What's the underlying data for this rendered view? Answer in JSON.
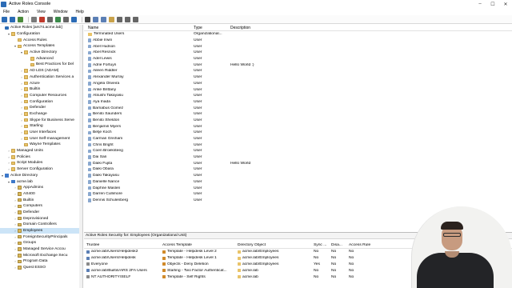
{
  "window": {
    "title": "Active Roles Console",
    "controls": [
      "–",
      "☐",
      "✕"
    ]
  },
  "menu": [
    "File",
    "Action",
    "View",
    "Window",
    "Help"
  ],
  "toolbar": [
    "back",
    "forward",
    "up",
    "show-tree",
    "delete",
    "properties",
    "refresh",
    "export",
    "help",
    "console-icon",
    "new-user",
    "new-group",
    "new-ou",
    "filter",
    "find",
    "settings"
  ],
  "tree": [
    {
      "label": "Active Roles [ars74.acme.lab]",
      "indent": 0,
      "exp": "",
      "icon": "root"
    },
    {
      "label": "Configuration",
      "indent": 1,
      "exp": "▾",
      "icon": "folder"
    },
    {
      "label": "Access Rules",
      "indent": 2,
      "exp": "",
      "icon": "folder"
    },
    {
      "label": "Access Templates",
      "indent": 2,
      "exp": "▾",
      "icon": "folder"
    },
    {
      "label": "Active Directory",
      "indent": 3,
      "exp": "▾",
      "icon": "folder"
    },
    {
      "label": "Advanced",
      "indent": 4,
      "exp": "",
      "icon": "folder"
    },
    {
      "label": "Best Practices for Del",
      "indent": 4,
      "exp": "",
      "icon": "folder"
    },
    {
      "label": "AD LDS (ADAM)",
      "indent": 3,
      "exp": "›",
      "icon": "folder"
    },
    {
      "label": "Authentication Services a",
      "indent": 3,
      "exp": "›",
      "icon": "folder"
    },
    {
      "label": "Azure",
      "indent": 3,
      "exp": "›",
      "icon": "folder"
    },
    {
      "label": "Builtin",
      "indent": 3,
      "exp": "›",
      "icon": "folder"
    },
    {
      "label": "Computer Resources",
      "indent": 3,
      "exp": "›",
      "icon": "folder"
    },
    {
      "label": "Configuration",
      "indent": 3,
      "exp": "›",
      "icon": "folder"
    },
    {
      "label": "Defender",
      "indent": 3,
      "exp": "›",
      "icon": "folder"
    },
    {
      "label": "Exchange",
      "indent": 3,
      "exp": "›",
      "icon": "folder"
    },
    {
      "label": "Skype for Business Serve",
      "indent": 3,
      "exp": "›",
      "icon": "folder"
    },
    {
      "label": "Starling",
      "indent": 3,
      "exp": "›",
      "icon": "folder"
    },
    {
      "label": "User Interfaces",
      "indent": 3,
      "exp": "›",
      "icon": "folder"
    },
    {
      "label": "User Self-management",
      "indent": 3,
      "exp": "›",
      "icon": "folder"
    },
    {
      "label": "Wayne Templates",
      "indent": 3,
      "exp": "",
      "icon": "folder"
    },
    {
      "label": "Managed Units",
      "indent": 1,
      "exp": "›",
      "icon": "folder"
    },
    {
      "label": "Policies",
      "indent": 1,
      "exp": "›",
      "icon": "folder"
    },
    {
      "label": "Script Modules",
      "indent": 1,
      "exp": "›",
      "icon": "folder"
    },
    {
      "label": "Server Configuration",
      "indent": 1,
      "exp": "›",
      "icon": "folder"
    },
    {
      "label": "Active Directory",
      "indent": 0,
      "exp": "▾",
      "icon": "node"
    },
    {
      "label": "acme.lab",
      "indent": 1,
      "exp": "▾",
      "icon": "node"
    },
    {
      "label": "AppAdmins",
      "indent": 2,
      "exp": "›",
      "icon": "ou"
    },
    {
      "label": "AS400",
      "indent": 2,
      "exp": "›",
      "icon": "ou"
    },
    {
      "label": "Builtin",
      "indent": 2,
      "exp": "›",
      "icon": "ou"
    },
    {
      "label": "Computers",
      "indent": 2,
      "exp": "›",
      "icon": "ou"
    },
    {
      "label": "Defender",
      "indent": 2,
      "exp": "›",
      "icon": "ou"
    },
    {
      "label": "Deprovisioned",
      "indent": 2,
      "exp": "›",
      "icon": "ou"
    },
    {
      "label": "Domain Controllers",
      "indent": 2,
      "exp": "›",
      "icon": "ou"
    },
    {
      "label": "Employees",
      "indent": 2,
      "exp": "›",
      "icon": "ou",
      "selected": true
    },
    {
      "label": "ForeignSecurityPrincipals",
      "indent": 2,
      "exp": "›",
      "icon": "ou"
    },
    {
      "label": "Groups",
      "indent": 2,
      "exp": "›",
      "icon": "ou"
    },
    {
      "label": "Managed Service Accou",
      "indent": 2,
      "exp": "›",
      "icon": "ou"
    },
    {
      "label": "Microsoft Exchange Secu",
      "indent": 2,
      "exp": "›",
      "icon": "ou"
    },
    {
      "label": "Program Data",
      "indent": 2,
      "exp": "›",
      "icon": "ou"
    },
    {
      "label": "Quest ESSO",
      "indent": 2,
      "exp": "›",
      "icon": "ou"
    }
  ],
  "list": {
    "columns": [
      "Name",
      "Type",
      "Description"
    ],
    "rows": [
      {
        "name": "Terminated Users",
        "type": "Organizational...",
        "desc": "",
        "icon": "folder"
      },
      {
        "name": "Abbie Irwin",
        "type": "User",
        "desc": "",
        "icon": "user"
      },
      {
        "name": "Abel Hudson",
        "type": "User",
        "desc": "",
        "icon": "user"
      },
      {
        "name": "Abel Resnick",
        "type": "User",
        "desc": "",
        "icon": "user"
      },
      {
        "name": "Adel Lewis",
        "type": "User",
        "desc": "",
        "icon": "user"
      },
      {
        "name": "Adrie Fortuyn",
        "type": "User",
        "desc": "Hello World :)",
        "icon": "user"
      },
      {
        "name": "Aileen Riddler",
        "type": "User",
        "desc": "",
        "icon": "user"
      },
      {
        "name": "Alexander Murray",
        "type": "User",
        "desc": "",
        "icon": "user"
      },
      {
        "name": "Angela Oliveira",
        "type": "User",
        "desc": "",
        "icon": "user"
      },
      {
        "name": "Anke Brittany",
        "type": "User",
        "desc": "",
        "icon": "user"
      },
      {
        "name": "Atsushi Takayasu",
        "type": "User",
        "desc": "",
        "icon": "user"
      },
      {
        "name": "Aya Inada",
        "type": "User",
        "desc": "",
        "icon": "user"
      },
      {
        "name": "Barnabus Gomez",
        "type": "User",
        "desc": "",
        "icon": "user"
      },
      {
        "name": "Benito Saunders",
        "type": "User",
        "desc": "",
        "icon": "user"
      },
      {
        "name": "Benito Sheldon",
        "type": "User",
        "desc": "",
        "icon": "user"
      },
      {
        "name": "Benjamin Myers",
        "type": "User",
        "desc": "",
        "icon": "user"
      },
      {
        "name": "Betje Koch",
        "type": "User",
        "desc": "",
        "icon": "user"
      },
      {
        "name": "Carman Grisham",
        "type": "User",
        "desc": "",
        "icon": "user"
      },
      {
        "name": "Chris Bright",
        "type": "User",
        "desc": "",
        "icon": "user"
      },
      {
        "name": "Coen Broeksteeg",
        "type": "User",
        "desc": "",
        "icon": "user"
      },
      {
        "name": "Dai San",
        "type": "User",
        "desc": "",
        "icon": "user"
      },
      {
        "name": "Daiki Fujita",
        "type": "User",
        "desc": "Hello World",
        "icon": "user"
      },
      {
        "name": "Daiki Obara",
        "type": "User",
        "desc": "",
        "icon": "user"
      },
      {
        "name": "Daiki Takayasu",
        "type": "User",
        "desc": "",
        "icon": "user"
      },
      {
        "name": "Danielle Nance",
        "type": "User",
        "desc": "",
        "icon": "user"
      },
      {
        "name": "Daphne Maslen",
        "type": "User",
        "desc": "",
        "icon": "user"
      },
      {
        "name": "Darren Cullimore",
        "type": "User",
        "desc": "",
        "icon": "user"
      },
      {
        "name": "Dennis Schulenberg",
        "type": "User",
        "desc": "",
        "icon": "user"
      }
    ]
  },
  "security": {
    "title": "Active Roles Security for: Employees (Organizational Unit)",
    "columns": [
      "Trustee",
      "Access Template",
      "Directory Object",
      "Sync ...",
      "Disa...",
      "Access Rule"
    ],
    "rows": [
      {
        "trustee": "acme.lab/Users/Helpdesk2",
        "template": "Template - Helpdesk Level 2",
        "object": "acme.lab/Employees",
        "sync": "No",
        "dis": "No",
        "rule": "No"
      },
      {
        "trustee": "acme.lab/Users/Helpdesk",
        "template": "Template - Helpdesk Level 1",
        "object": "acme.lab/Employees",
        "sync": "No",
        "dis": "No",
        "rule": "No"
      },
      {
        "trustee": "Everyone",
        "template": "Objects - Deny Deletion",
        "object": "acme.lab/Employees",
        "sync": "Yes",
        "dis": "No",
        "rule": "No"
      },
      {
        "trustee": "acme.lab/Builtin/ARS 2FA Users",
        "template": "Starling - Two Factor Authenticat...",
        "object": "acme.lab",
        "sync": "No",
        "dis": "No",
        "rule": "No"
      },
      {
        "trustee": "NT AUTHORITY\\SELF",
        "template": "Template - Self Rights",
        "object": "acme.lab",
        "sync": "No",
        "dis": "No",
        "rule": "No"
      }
    ]
  },
  "colors": {
    "accent": "#2b6bb5",
    "selection": "#cce4f7",
    "folder": "#e9c46a"
  }
}
